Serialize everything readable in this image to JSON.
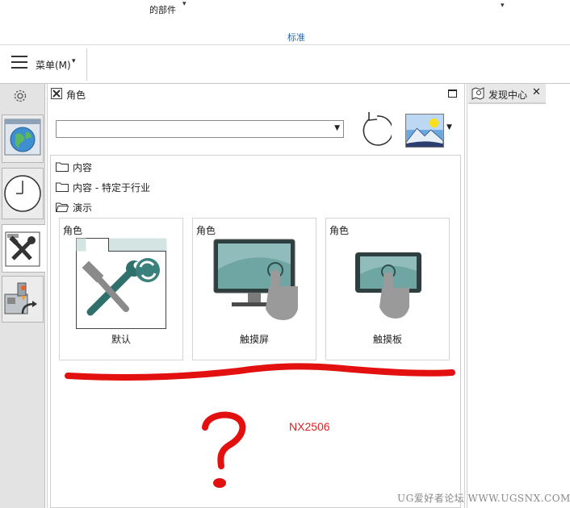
{
  "ribbon": {
    "gallery_label": "的部件",
    "group_label": "标准"
  },
  "menubar": {
    "menu_label": "菜单(M)"
  },
  "panel": {
    "title": "角色",
    "role_select_value": ""
  },
  "tree": [
    {
      "label": "内容"
    },
    {
      "label": "内容 - 特定于行业"
    },
    {
      "label": "演示"
    }
  ],
  "cards": [
    {
      "title": "角色",
      "name": "默认",
      "icon": "wrench-hammer-icon"
    },
    {
      "title": "角色",
      "name": "触摸屏",
      "icon": "touch-monitor-icon"
    },
    {
      "title": "角色",
      "name": "触摸板",
      "icon": "touch-tablet-icon"
    }
  ],
  "discovery": {
    "tab_label": "发现中心"
  },
  "annotation": {
    "version_label": "NX2506"
  },
  "watermark": "UG爱好者论坛 WWW.UGSNX.COM",
  "colors": {
    "accent": "#2a6bb5",
    "annotation_red": "#e02020"
  }
}
